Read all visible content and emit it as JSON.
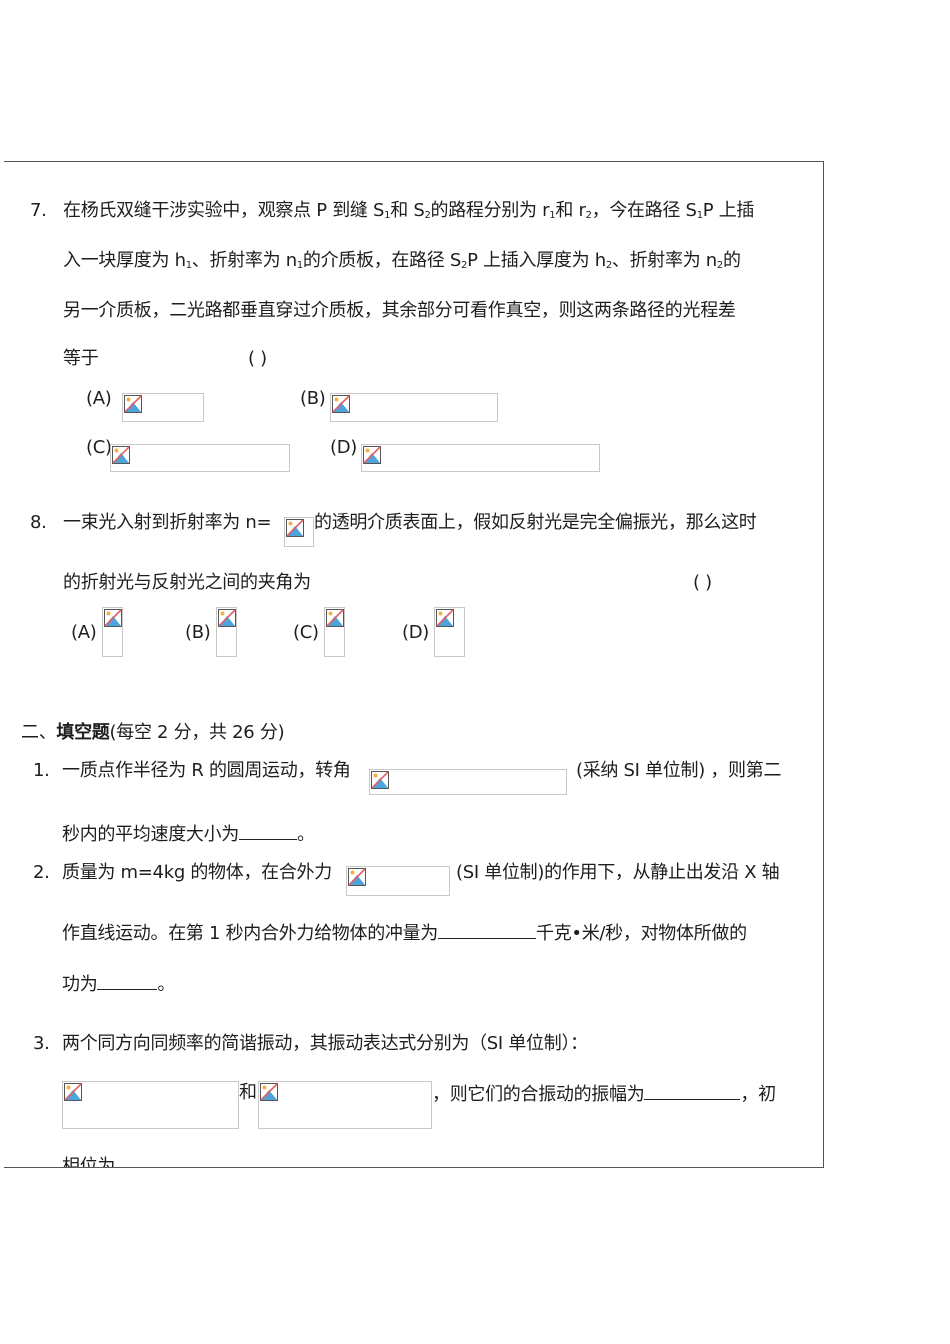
{
  "q7": {
    "num": "7.",
    "l1a": "在杨氏双缝干涉实验中，观察点 P 到缝 S",
    "s1": "1",
    "l1b": "和 S",
    "s2": "2",
    "l1c": "的路程分别为 r",
    "r1": "1",
    "l1d": "和 r",
    "r2": "2",
    "l1e": "，今在路径 S",
    "s1b": "1",
    "l1f": "P 上插",
    "l2a": "入一块厚度为 h",
    "h1": "1",
    "l2b": "、折射率为 n",
    "n1": "1",
    "l2c": "的介质板，在路径 S",
    "s2b": "2",
    "l2d": "P 上插入厚度为 h",
    "h2": "2",
    "l2e": "、折射率为 n",
    "n2": "2",
    "l2f": "的",
    "l3": "另一介质板，二光路都垂直穿过介质板，其余部分可看作真空，则这两条路径的光程差",
    "l4": "等于",
    "paren": "(    )",
    "options": [
      "(A)",
      "(B)",
      "(C)",
      "(D)"
    ]
  },
  "q8": {
    "num": "8.",
    "l1a": "一束光入射到折射率为 n=",
    "l1b": "的透明介质表面上，假如反射光是完全偏振光，那么这时",
    "l2": "的折射光与反射光之间的夹角为",
    "paren": "(    )",
    "options": [
      "(A)",
      "(B)",
      "(C)",
      "(D)"
    ]
  },
  "section2": {
    "title_prefix": "二、",
    "title": "填空题",
    "note": "(每空 2 分，共 26 分)"
  },
  "f1": {
    "num": "1.",
    "l1a": "一质点作半径为 R 的圆周运动，转角",
    "l1b": "(采纳 SI 单位制) ，则第二",
    "l2a": "秒内的平均速度大小为",
    "l2b": "。"
  },
  "f2": {
    "num": "2.",
    "l1a": "质量为 m=4kg 的物体，在合外力",
    "l1b": "(SI 单位制)的作用下，从静止出发沿 X 轴",
    "l2a": "作直线运动。在第 1 秒内合外力给物体的冲量为",
    "l2b": "千克•米/秒，对物体所做的",
    "l3a": "功为",
    "l3b": "。"
  },
  "f3": {
    "num": "3.",
    "l1": "两个同方向同频率的简谐振动，其振动表达式分别为（SI 单位制）：",
    "and": "和",
    "l2a": "，则它们的合振动的振幅为",
    "l2b": "，初",
    "l3": "相位为"
  }
}
